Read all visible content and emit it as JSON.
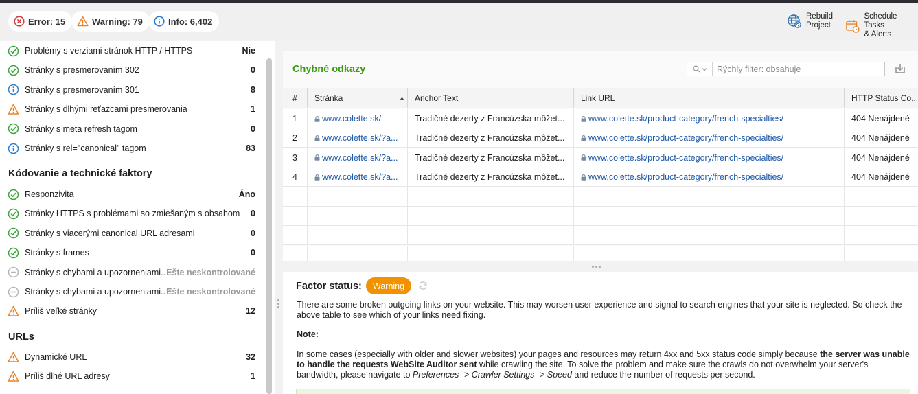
{
  "header": {
    "error": "Error: 15",
    "warning": "Warning: 79",
    "info": "Info: 6,402",
    "rebuild_line1": "Rebuild",
    "rebuild_line2": "Project",
    "schedule_line1": "Schedule Tasks",
    "schedule_line2": "& Alerts"
  },
  "sidebar": {
    "group1": [
      {
        "icon": "check-circle-icon",
        "label": "Problémy s verziami stránok HTTP / HTTPS",
        "value": "Nie"
      },
      {
        "icon": "check-circle-icon",
        "label": "Stránky s presmerovaním 302",
        "value": "0"
      },
      {
        "icon": "info-circle-icon",
        "label": "Stránky s presmerovaním 301",
        "value": "8"
      },
      {
        "icon": "warning-triangle-icon",
        "label": "Stránky s dlhými reťazcami presmerovania",
        "value": "1"
      },
      {
        "icon": "check-circle-icon",
        "label": "Stránky s meta refresh tagom",
        "value": "0"
      },
      {
        "icon": "info-circle-icon",
        "label": "Stránky s rel=\"canonical\" tagom",
        "value": "83"
      }
    ],
    "section2_title": "Kódovanie a technické faktory",
    "group2": [
      {
        "icon": "check-circle-icon",
        "label": "Responzivita",
        "value": "Áno"
      },
      {
        "icon": "check-circle-icon",
        "label": "Stránky HTTPS s problémami so zmiešaným s obsahom",
        "value": "0"
      },
      {
        "icon": "check-circle-icon",
        "label": "Stránky s viacerými canonical URL adresami",
        "value": "0"
      },
      {
        "icon": "check-circle-icon",
        "label": "Stránky s frames",
        "value": "0"
      },
      {
        "icon": "neutral-circle-icon",
        "label": "Stránky s chybami a upozorneniami...",
        "value": "Ešte neskontrolované"
      },
      {
        "icon": "neutral-circle-icon",
        "label": "Stránky s chybami a upozorneniami...",
        "value": "Ešte neskontrolované"
      },
      {
        "icon": "warning-triangle-icon",
        "label": "Príliš veľké stránky",
        "value": "12"
      }
    ],
    "section3_title": "URLs",
    "group3": [
      {
        "icon": "warning-triangle-icon",
        "label": "Dynamické URL",
        "value": "32"
      },
      {
        "icon": "warning-triangle-icon",
        "label": "Príliš dlhé URL adresy",
        "value": "1"
      }
    ]
  },
  "panel": {
    "title": "Chybné odkazy",
    "filter_placeholder": "Rýchly filter: obsahuje",
    "columns": [
      "#",
      "Stránka",
      "Anchor Text",
      "Link URL",
      "HTTP Status Co..."
    ],
    "rows": [
      {
        "num": "1",
        "page": "www.colette.sk/",
        "anchor": "Tradičné dezerty z Francúzska môžet...",
        "link": "www.colette.sk/product-category/french-specialties/",
        "status": "404 Nenájdené"
      },
      {
        "num": "2",
        "page": "www.colette.sk/?a...",
        "anchor": "Tradičné dezerty z Francúzska môžet...",
        "link": "www.colette.sk/product-category/french-specialties/",
        "status": "404 Nenájdené"
      },
      {
        "num": "3",
        "page": "www.colette.sk/?a...",
        "anchor": "Tradičné dezerty z Francúzska môžet...",
        "link": "www.colette.sk/product-category/french-specialties/",
        "status": "404 Nenájdené"
      },
      {
        "num": "4",
        "page": "www.colette.sk/?a...",
        "anchor": "Tradičné dezerty z Francúzska môžet...",
        "link": "www.colette.sk/product-category/french-specialties/",
        "status": "404 Nenájdené"
      }
    ]
  },
  "factor": {
    "label": "Factor status:",
    "badge": "Warning",
    "badge_color": "#f39200",
    "desc": "There are some broken outgoing links on your website. This may worsen user experience and signal to search engines that your site is neglected. So check the above table to see which of your links need fixing.",
    "note_title": "Note:",
    "note_p1": "In some cases (especially with older and slower websites) your pages and resources may return 4xx and 5xx status code simply because ",
    "note_bold": "the server was unable to handle the requests WebSite Auditor sent",
    "note_p2": " while crawling the site. To solve the problem and make sure the crawls do not overwhelm your server's bandwidth, please navigate to ",
    "note_italic": "Preferences -> Crawler Settings -> Speed",
    "note_p3": " and reduce the number of requests per second."
  }
}
